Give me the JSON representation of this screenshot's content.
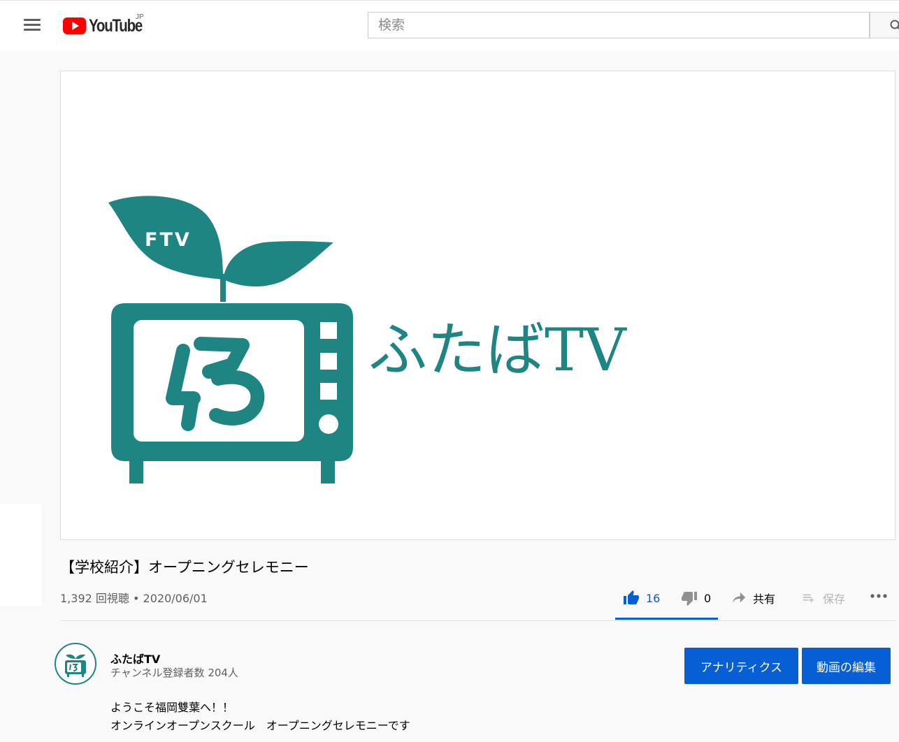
{
  "header": {
    "logo_text": "YouTube",
    "country_code": "JP",
    "search_placeholder": "検索"
  },
  "video": {
    "thumbnail": {
      "logo_badge": "FTV",
      "brand_text": "ふたばTV",
      "brand_color": "#1e8582"
    },
    "title": "【学校紹介】オープニングセレモニー",
    "views": "1,392 回視聴",
    "separator": "•",
    "date": "2020/06/01",
    "actions": {
      "likes": "16",
      "dislikes": "0",
      "share_label": "共有",
      "save_label": "保存"
    }
  },
  "channel": {
    "name": "ふたばTV",
    "subscribers": "チャンネル登録者数 204人",
    "analytics_button": "アナリティクス",
    "edit_button": "動画の編集"
  },
  "description": {
    "line1": "ようこそ福岡雙葉へ！！",
    "line2": "オンラインオープンスクール　オープニングセレモニーです"
  },
  "colors": {
    "accent_blue": "#065fd4",
    "youtube_red": "#ff0000",
    "teal": "#1e8582"
  }
}
